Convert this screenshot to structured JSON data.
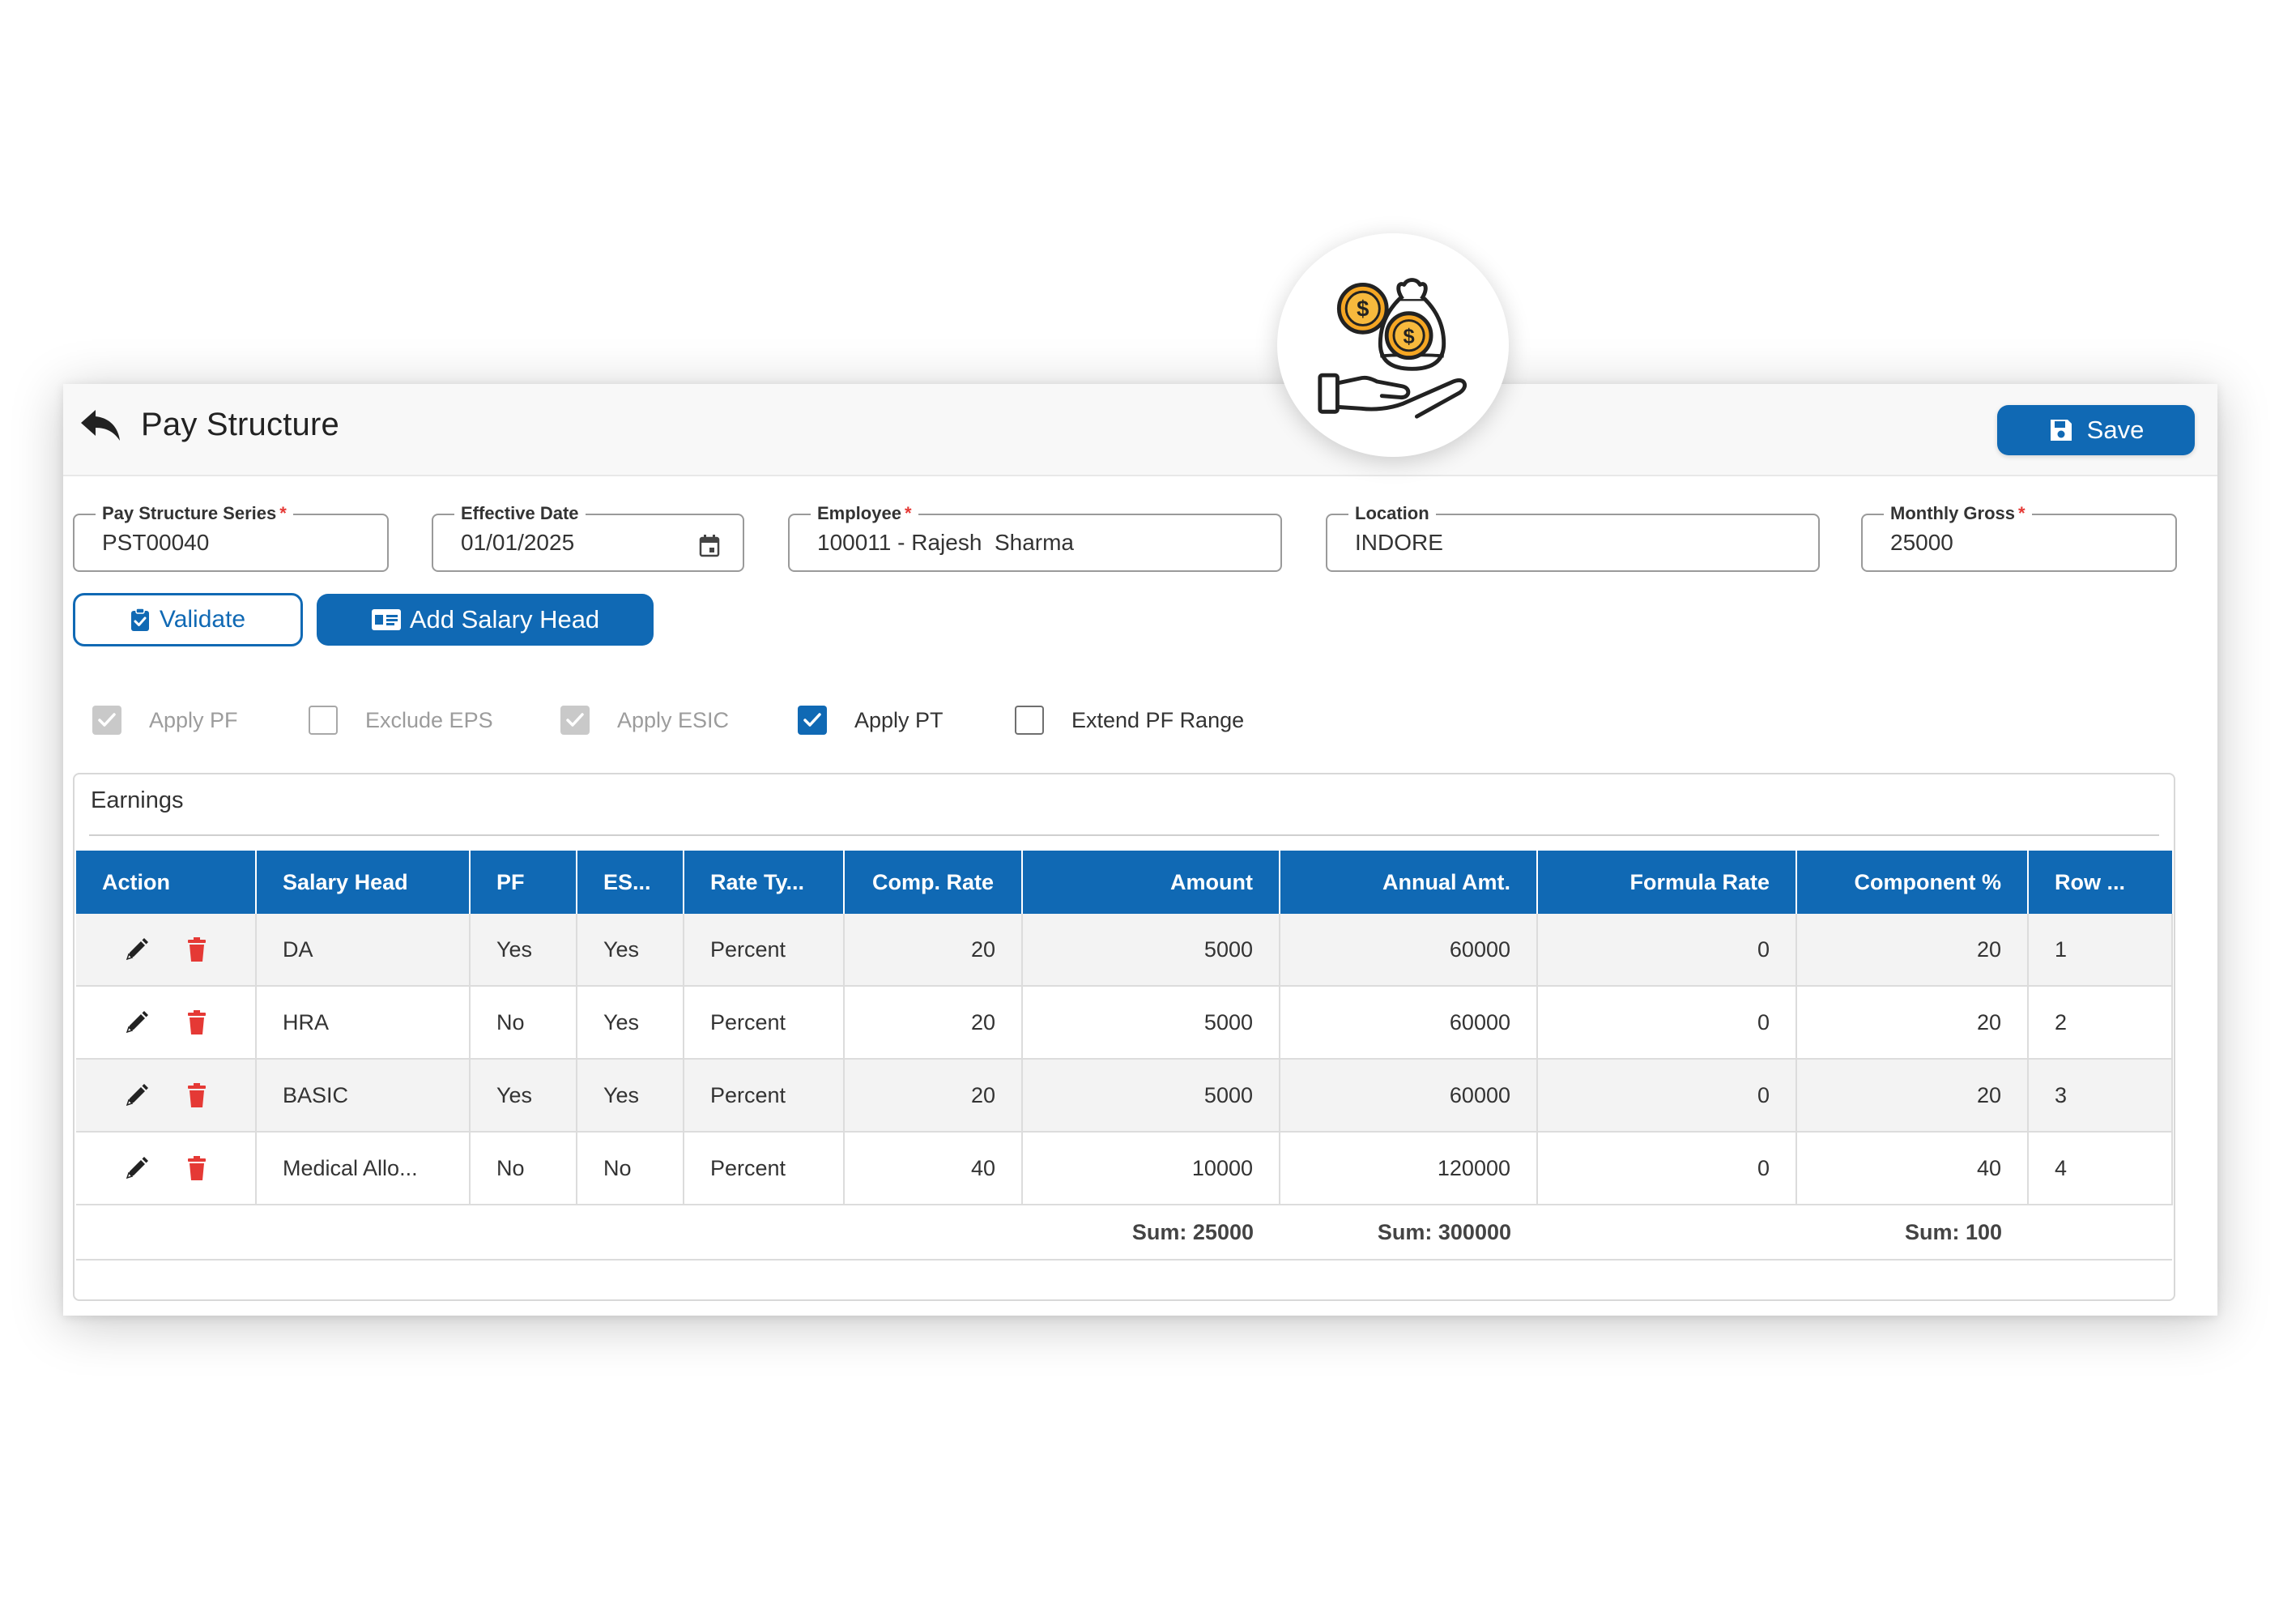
{
  "header": {
    "title": "Pay Structure",
    "save_label": "Save"
  },
  "form": {
    "pay_structure_series": {
      "label": "Pay Structure Series",
      "required": true,
      "value": "PST00040"
    },
    "effective_date": {
      "label": "Effective Date",
      "required": false,
      "value": "01/01/2025"
    },
    "employee": {
      "label": "Employee",
      "required": true,
      "value": "100011 - Rajesh  Sharma"
    },
    "location": {
      "label": "Location",
      "required": false,
      "value": "INDORE"
    },
    "monthly_gross": {
      "label": "Monthly Gross",
      "required": true,
      "value": "25000"
    }
  },
  "buttons": {
    "validate": "Validate",
    "add_salary_head": "Add Salary Head"
  },
  "options": [
    {
      "label": "Apply PF",
      "checked": true,
      "disabled": true
    },
    {
      "label": "Exclude EPS",
      "checked": false,
      "disabled": true
    },
    {
      "label": "Apply ESIC",
      "checked": true,
      "disabled": true
    },
    {
      "label": "Apply PT",
      "checked": true,
      "disabled": false
    },
    {
      "label": "Extend PF Range",
      "checked": false,
      "disabled": false
    }
  ],
  "earnings": {
    "title": "Earnings",
    "columns": [
      "Action",
      "Salary Head",
      "PF",
      "ES...",
      "Rate Ty...",
      "Comp. Rate",
      "Amount",
      "Annual Amt.",
      "Formula Rate",
      "Component %",
      "Row ..."
    ],
    "rows": [
      {
        "salary_head": "DA",
        "pf": "Yes",
        "esic": "Yes",
        "rate_type": "Percent",
        "comp_rate": "20",
        "amount": "5000",
        "annual_amt": "60000",
        "formula_rate": "0",
        "component_pct": "20",
        "row": "1"
      },
      {
        "salary_head": "HRA",
        "pf": "No",
        "esic": "Yes",
        "rate_type": "Percent",
        "comp_rate": "20",
        "amount": "5000",
        "annual_amt": "60000",
        "formula_rate": "0",
        "component_pct": "20",
        "row": "2"
      },
      {
        "salary_head": "BASIC",
        "pf": "Yes",
        "esic": "Yes",
        "rate_type": "Percent",
        "comp_rate": "20",
        "amount": "5000",
        "annual_amt": "60000",
        "formula_rate": "0",
        "component_pct": "20",
        "row": "3"
      },
      {
        "salary_head": "Medical Allo...",
        "pf": "No",
        "esic": "No",
        "rate_type": "Percent",
        "comp_rate": "40",
        "amount": "10000",
        "annual_amt": "120000",
        "formula_rate": "0",
        "component_pct": "40",
        "row": "4"
      }
    ],
    "sums": {
      "amount": "Sum: 25000",
      "annual_amt": "Sum: 300000",
      "component_pct": "Sum: 100"
    }
  },
  "colors": {
    "primary": "#1069b4",
    "danger": "#e53935",
    "coin": "#f5a623"
  },
  "icons": [
    "back-arrow-icon",
    "save-icon",
    "calendar-icon",
    "clipboard-check-icon",
    "id-card-icon",
    "edit-pencil-icon",
    "trash-icon",
    "money-bag-hand-icon"
  ]
}
